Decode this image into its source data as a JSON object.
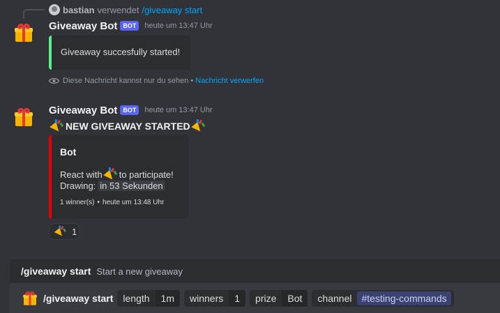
{
  "reply": {
    "user": "bastian",
    "verb": "verwendet",
    "command": "/giveaway start"
  },
  "message1": {
    "author": "Giveaway Bot",
    "bot_tag": "BOT",
    "timestamp": "heute um 13:47 Uhr",
    "embed_text": "Giveaway succesfully started!",
    "embed_color": "#57f287",
    "ephemeral_text": "Diese Nachricht kannst nur du sehen",
    "ephemeral_sep": "•",
    "ephemeral_link": "Nachricht verwerfen"
  },
  "message2": {
    "author": "Giveaway Bot",
    "bot_tag": "BOT",
    "timestamp": "heute um 13:47 Uhr",
    "headline": "NEW GIVEAWAY STARTED",
    "embed": {
      "color": "#e50000",
      "title": "Bot",
      "react_prefix": "React with",
      "react_suffix": "to participate!",
      "drawing_label": "Drawing:",
      "drawing_value": "in 53 Sekunden",
      "footer_winners": "1 winner(s)",
      "footer_sep": "•",
      "footer_time": "heute um 13:48 Uhr"
    },
    "reaction": {
      "icon": "tada-icon",
      "count": "1"
    }
  },
  "suggestion": {
    "name": "/giveaway start",
    "description": "Start a new giveaway"
  },
  "composer": {
    "command": "/giveaway start",
    "options": [
      {
        "name": "length",
        "value": "1m"
      },
      {
        "name": "winners",
        "value": "1"
      },
      {
        "name": "prize",
        "value": "Bot"
      },
      {
        "name": "channel",
        "value": "#testing-commands"
      }
    ]
  },
  "colors": {
    "background": "#313338",
    "link": "#00a8fc",
    "bot_tag": "#5865f2"
  }
}
